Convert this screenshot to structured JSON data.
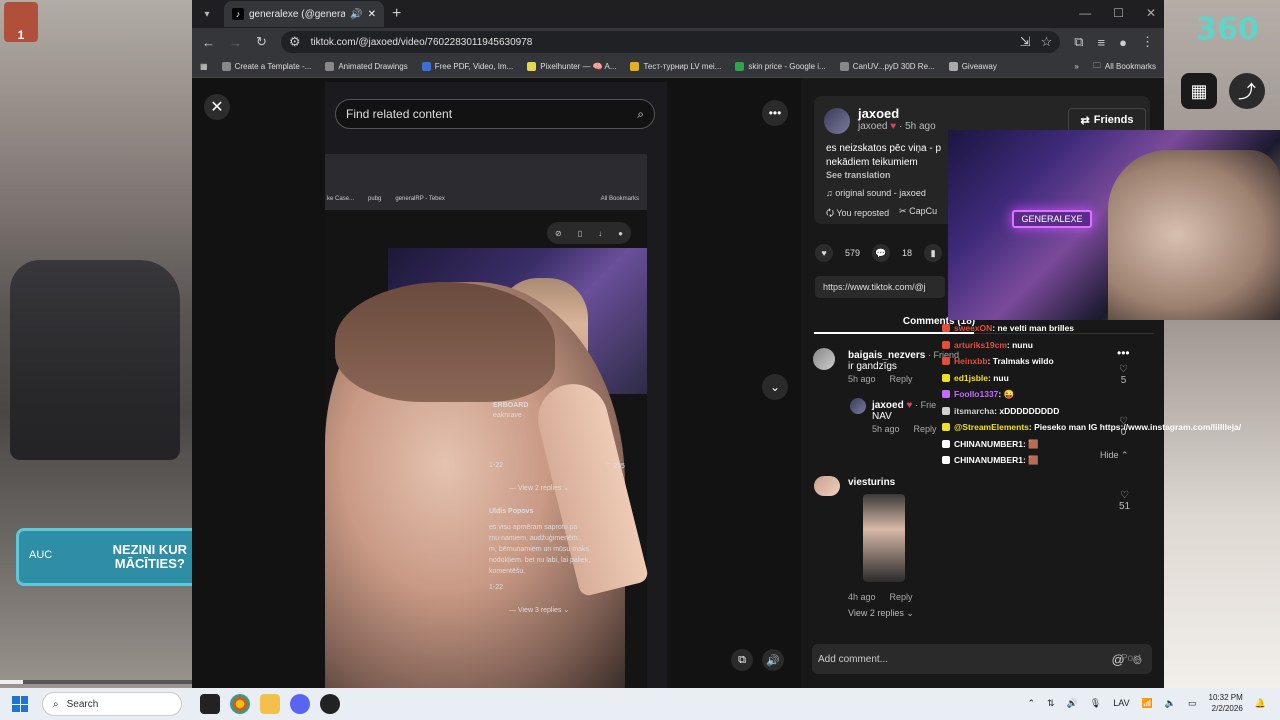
{
  "overlay": {
    "streamer_icon_text": "1",
    "logo": "360",
    "ad_badge": {
      "prefix": "AUC",
      "text_line1": "NEZINI KUR",
      "text_line2": "MĀCĪTIES?"
    },
    "progress": {
      "fraction": 0.12
    }
  },
  "browser": {
    "tab_title": "generalexe (@generalexe)",
    "url": "tiktok.com/@jaxoed/video/7602283011945630978",
    "bookmarks": [
      "Create a Template -...",
      "Animated Drawings",
      "Free PDF, Video, Im...",
      "Pixelhunter — 🧠 A...",
      "Тест-турнир LV mei...",
      "skin price - Google i...",
      "CanUV...pyD 30D Re...",
      "Giveaway"
    ],
    "all_bookmarks": "All Bookmarks"
  },
  "video": {
    "search_placeholder": "Find related content",
    "inner_bookmarks": [
      "ke Case...",
      "pubg",
      "generalRP - Tebex",
      "All Bookmarks"
    ],
    "neon_sign": "GENERALEXE",
    "overlay_name": "ERBOARD",
    "overlay_sub": "eaknrave",
    "time1": "1-22",
    "likes1": "205",
    "view2_replies": "View 2 replies",
    "commenter": "Uldis Popovs",
    "comment_lines": [
      "es visu apmēram saprotu pa",
      "rnu namiem, audžuģimenēm ,",
      "m, bērnunamiem un mūsu maks.",
      "nodokļiem. bet nu labi, lai paliek,",
      "komentēšu."
    ],
    "time2": "1-22",
    "view3_replies": "View 3 replies"
  },
  "panel": {
    "author_name": "jaxoed",
    "author_handle": "jaxoed",
    "author_time": "5h ago",
    "friends_label": "Friends",
    "description_line1": "es neizskatos pēc viņa - p",
    "description_line2": "nekādiem teikumiem",
    "see_translation": "See translation",
    "sound": "original sound - jaxoed",
    "you_reposted": "You reposted",
    "capcut": "CapCu",
    "likes": "579",
    "comments_count": "18",
    "link": "https://www.tiktok.com/@j",
    "comments_tab": "Comments (18)",
    "comments": [
      {
        "user": "baigais_nezvers",
        "tag": "· Friend",
        "text": "ir gandzīgs",
        "time": "5h ago",
        "reply": "Reply",
        "likes": "5"
      },
      {
        "user": "jaxoed",
        "tag": "· Frie",
        "text": "NAV",
        "time": "5h ago",
        "reply": "Reply",
        "likes": "0"
      },
      {
        "user": "viesturins",
        "text": "",
        "time": "4h ago",
        "reply": "Reply",
        "likes": "51"
      }
    ],
    "hide_label": "Hide",
    "view_more": "View 2 replies",
    "add_comment": "Add comment...",
    "post_label": "Post"
  },
  "chat": [
    {
      "user": "sweexON",
      "msg": ": ne velti man brilles",
      "color": "#e64c3c"
    },
    {
      "user": "arturiks19cm",
      "msg": ": nunu",
      "color": "#e64c3c"
    },
    {
      "user": "Heinxbb",
      "msg": ": Tralmaks wildo",
      "color": "#e64c3c"
    },
    {
      "user": "ed1jsble",
      "msg": ": nuu",
      "color": "#f0e020"
    },
    {
      "user": "Foollo1337",
      "msg": ": 😜",
      "color": "#c26bff"
    },
    {
      "user": "itsmarcha",
      "msg": ": xDDDDDDDDD",
      "color": "#cfcfcf"
    },
    {
      "user": "@StreamElements",
      "msg": ": Pieseko man IG https://www.instagram.com/lilllleja/",
      "color": "#f0e020"
    },
    {
      "user": "CHINANUMBER1",
      "msg": ": 🟫",
      "color": "#ffffff"
    },
    {
      "user": "CHINANUMBER1",
      "msg": ": 🟫",
      "color": "#ffffff"
    }
  ],
  "taskbar": {
    "search": "Search",
    "lang": "LAV",
    "time": "10:32 PM",
    "date": "2/2/2026"
  }
}
